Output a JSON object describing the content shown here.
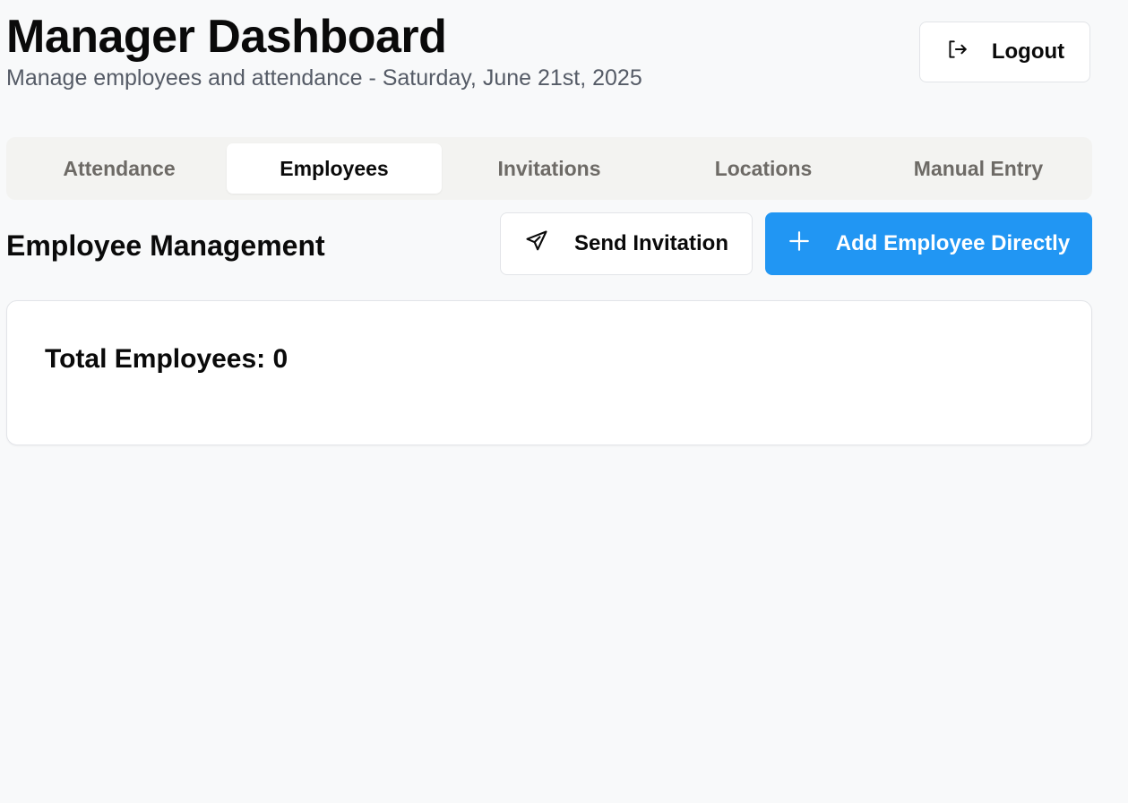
{
  "header": {
    "title": "Manager Dashboard",
    "subtitle": "Manage employees and attendance - Saturday, June 21st, 2025",
    "logout_label": "Logout",
    "logout_icon": "logout-icon"
  },
  "tabs": [
    {
      "label": "Attendance",
      "active": false
    },
    {
      "label": "Employees",
      "active": true
    },
    {
      "label": "Invitations",
      "active": false
    },
    {
      "label": "Locations",
      "active": false
    },
    {
      "label": "Manual Entry",
      "active": false
    }
  ],
  "section": {
    "title": "Employee Management",
    "send_invitation_label": "Send Invitation",
    "send_invitation_icon": "send-icon",
    "add_employee_label": "Add Employee Directly",
    "add_employee_icon": "plus-icon"
  },
  "summary": {
    "total_text": "Total Employees: 0"
  },
  "colors": {
    "accent": "#2196f3",
    "background": "#f8f9fa",
    "tab_bar": "#f3f3f1"
  }
}
